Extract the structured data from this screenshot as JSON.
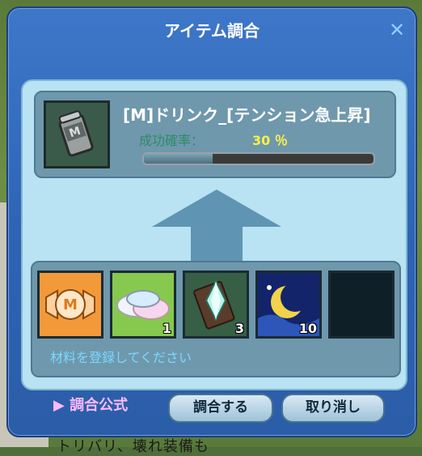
{
  "window": {
    "title": "アイテム調合",
    "close_icon": "close-icon"
  },
  "result": {
    "name": "[M]ドリンク_[テンション急上昇]",
    "success_rate_label": "成功確率：",
    "success_rate_value": "30 ％",
    "success_rate_fraction": 0.3,
    "icon": "item-drink-icon"
  },
  "materials": {
    "slots": [
      {
        "icon": "candy-icon",
        "count": ""
      },
      {
        "icon": "marshmallow-icon",
        "count": "1"
      },
      {
        "icon": "crystal-card-icon",
        "count": "3"
      },
      {
        "icon": "moon-night-icon",
        "count": "10"
      },
      {
        "icon": "empty-slot",
        "count": ""
      }
    ],
    "hint": "材料を登録してください"
  },
  "footer": {
    "formula_label": "▶ 調合公式",
    "craft_button": "調合する",
    "cancel_button": "取り消し"
  },
  "background_text": "トリバリ、壊れ装備も"
}
